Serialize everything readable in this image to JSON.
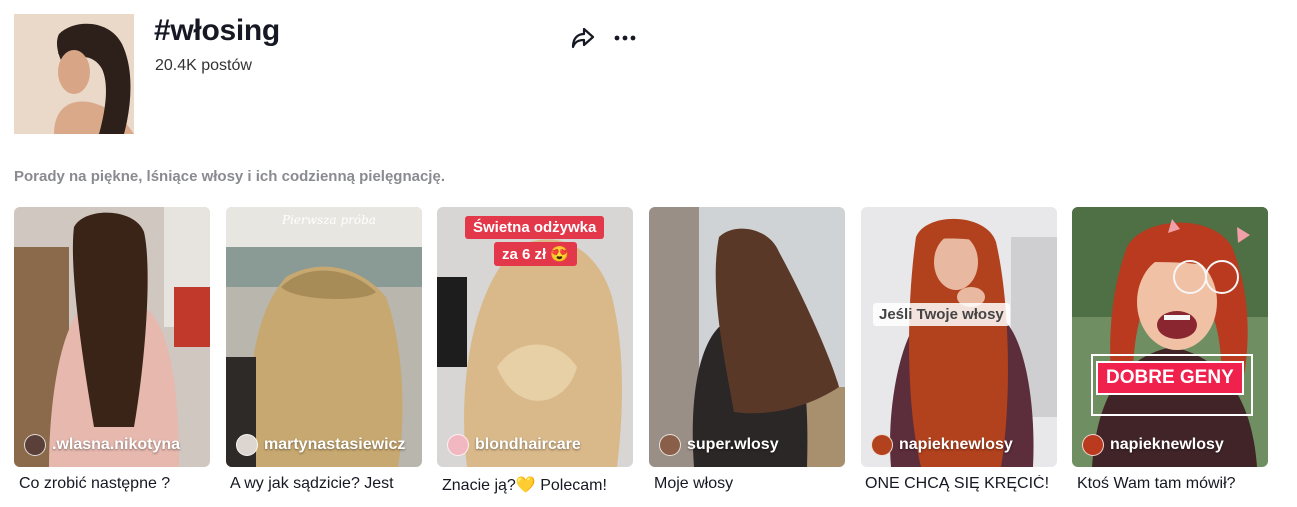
{
  "header": {
    "title": "#włosing",
    "post_count": "20.4K postów",
    "share_icon": "share-arrow-icon",
    "more_icon": "ellipsis-icon"
  },
  "description": "Porady na piękne, lśniące włosy i ich codzienną pielęgnację.",
  "videos": [
    {
      "author": ".wlasna.nikotyna",
      "caption": "Co zrobić następne ?"
    },
    {
      "author": "martynastasiewicz",
      "caption": "A wy jak sądzicie? Jest",
      "overlay": "Pierwsza próba"
    },
    {
      "author": "blondhaircare",
      "caption": "Znacie ją?💛 Polecam!",
      "overlay_line1": "Świetna odżywka",
      "overlay_line2": "za 6 zł 😍"
    },
    {
      "author": "super.wlosy",
      "caption": "Moje włosy"
    },
    {
      "author": "napieknewlosy",
      "caption": "ONE CHCĄ SIĘ KRĘCIĆ!",
      "overlay": "Jeśli Twoje włosy"
    },
    {
      "author": "napieknewlosy",
      "caption": "Ktoś Wam tam mówił?",
      "overlay": "DOBRE GENY"
    }
  ]
}
